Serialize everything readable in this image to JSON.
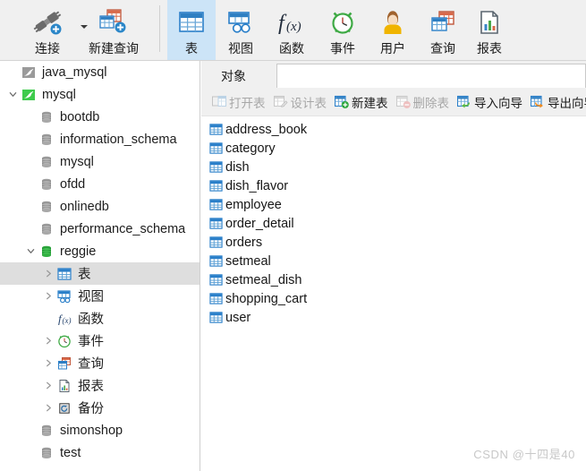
{
  "ribbon": {
    "items": [
      {
        "label": "连接",
        "icon": "connection-plug-icon",
        "has_caret": true,
        "active": false
      },
      {
        "label": "新建查询",
        "icon": "new-query-icon",
        "has_caret": false,
        "active": false
      },
      {
        "label": "表",
        "icon": "table-icon",
        "has_caret": false,
        "active": true
      },
      {
        "label": "视图",
        "icon": "view-icon",
        "has_caret": false,
        "active": false
      },
      {
        "label": "函数",
        "icon": "function-fx-icon",
        "has_caret": false,
        "active": false
      },
      {
        "label": "事件",
        "icon": "event-clock-icon",
        "has_caret": false,
        "active": false
      },
      {
        "label": "用户",
        "icon": "user-icon",
        "has_caret": false,
        "active": false
      },
      {
        "label": "查询",
        "icon": "query-icon",
        "has_caret": false,
        "active": false
      },
      {
        "label": "报表",
        "icon": "report-icon",
        "has_caret": false,
        "active": false
      }
    ],
    "accent_active_bg": "#cce4f7",
    "background": "#f0f0f0"
  },
  "sidebar": {
    "nodes": [
      {
        "label": "java_mysql",
        "icon": "mysql-dolphin-gray-icon",
        "indent": 1,
        "twisty": "none",
        "selected": false
      },
      {
        "label": "mysql",
        "icon": "mysql-dolphin-green-icon",
        "indent": 1,
        "twisty": "expanded",
        "selected": false
      },
      {
        "label": "bootdb",
        "icon": "database-gray-icon",
        "indent": 2,
        "twisty": "none",
        "selected": false
      },
      {
        "label": "information_schema",
        "icon": "database-gray-icon",
        "indent": 2,
        "twisty": "none",
        "selected": false
      },
      {
        "label": "mysql",
        "icon": "database-gray-icon",
        "indent": 2,
        "twisty": "none",
        "selected": false
      },
      {
        "label": "ofdd",
        "icon": "database-gray-icon",
        "indent": 2,
        "twisty": "none",
        "selected": false
      },
      {
        "label": "onlinedb",
        "icon": "database-gray-icon",
        "indent": 2,
        "twisty": "none",
        "selected": false
      },
      {
        "label": "performance_schema",
        "icon": "database-gray-icon",
        "indent": 2,
        "twisty": "none",
        "selected": false
      },
      {
        "label": "reggie",
        "icon": "database-green-icon",
        "indent": 2,
        "twisty": "expanded",
        "selected": false
      },
      {
        "label": "表",
        "icon": "table-icon",
        "indent": 3,
        "twisty": "collapsed",
        "selected": true
      },
      {
        "label": "视图",
        "icon": "view-icon",
        "indent": 3,
        "twisty": "collapsed",
        "selected": false
      },
      {
        "label": "函数",
        "icon": "function-fx-icon",
        "indent": 3,
        "twisty": "none",
        "selected": false
      },
      {
        "label": "事件",
        "icon": "event-clock-icon",
        "indent": 3,
        "twisty": "collapsed",
        "selected": false
      },
      {
        "label": "查询",
        "icon": "query-icon",
        "indent": 3,
        "twisty": "collapsed",
        "selected": false
      },
      {
        "label": "报表",
        "icon": "report-icon",
        "indent": 3,
        "twisty": "collapsed",
        "selected": false
      },
      {
        "label": "备份",
        "icon": "backup-icon",
        "indent": 3,
        "twisty": "collapsed",
        "selected": false
      },
      {
        "label": "simonshop",
        "icon": "database-gray-icon",
        "indent": 2,
        "twisty": "none",
        "selected": false
      },
      {
        "label": "test",
        "icon": "database-gray-icon",
        "indent": 2,
        "twisty": "none",
        "selected": false
      }
    ],
    "selected_row_bg": "#dedede"
  },
  "objectPanel": {
    "tab": {
      "label": "对象"
    },
    "toolbar": [
      {
        "label": "打开表",
        "icon": "open-table-icon",
        "enabled": false
      },
      {
        "label": "设计表",
        "icon": "design-table-icon",
        "enabled": false
      },
      {
        "label": "新建表",
        "icon": "new-table-icon",
        "enabled": true
      },
      {
        "label": "删除表",
        "icon": "delete-table-icon",
        "enabled": false
      },
      {
        "label": "导入向导",
        "icon": "import-wizard-icon",
        "enabled": true
      },
      {
        "label": "导出向导",
        "icon": "export-wizard-icon",
        "enabled": true
      }
    ],
    "tables": [
      {
        "name": "address_book",
        "icon": "table-icon"
      },
      {
        "name": "category",
        "icon": "table-icon"
      },
      {
        "name": "dish",
        "icon": "table-icon"
      },
      {
        "name": "dish_flavor",
        "icon": "table-icon"
      },
      {
        "name": "employee",
        "icon": "table-icon"
      },
      {
        "name": "order_detail",
        "icon": "table-icon"
      },
      {
        "name": "orders",
        "icon": "table-icon"
      },
      {
        "name": "setmeal",
        "icon": "table-icon"
      },
      {
        "name": "setmeal_dish",
        "icon": "table-icon"
      },
      {
        "name": "shopping_cart",
        "icon": "table-icon"
      },
      {
        "name": "user",
        "icon": "table-icon"
      }
    ]
  },
  "watermark": {
    "text": "CSDN @十四是40"
  }
}
